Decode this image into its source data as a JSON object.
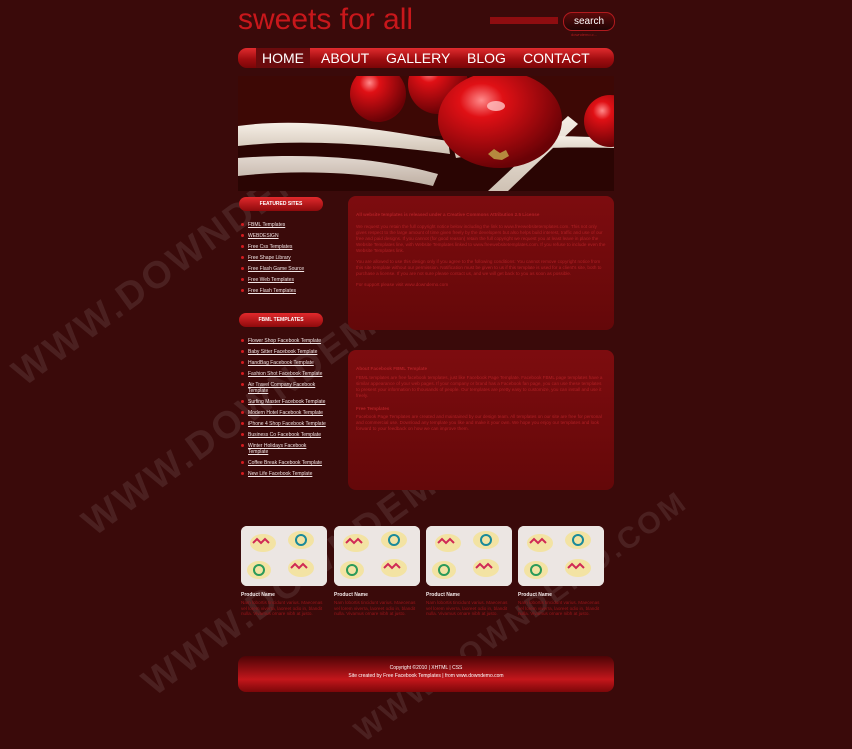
{
  "site": {
    "title": "sweets for all"
  },
  "search": {
    "button_label": "search",
    "note": "downdemo.c..."
  },
  "nav": {
    "items": [
      "HOME",
      "ABOUT",
      "GALLERY",
      "BLOG",
      "CONTACT"
    ]
  },
  "sidebar": {
    "featured_heading": "FEATURED SITES",
    "featured_items": [
      "FBML Templates",
      "WEBDESIGN",
      "Free Css Templates",
      "Free Shape Library",
      "Free Flash Game Source",
      "Free Web Templates",
      "Free Flash Templates"
    ],
    "fbml_heading": "FBML TEMPLATES",
    "fbml_items": [
      "Flower Shop Facebook Template",
      "Baby Sitter Facebook Template",
      "HandBag Facebook Template",
      "Fashion Shot Facebook Template",
      "Air Travel Company Facebook Template",
      "Surfing Master Facebook Template",
      "Modern Hotel Facebook Template",
      "iPhone 4 Shop Facebook Template",
      "Business Co Facebook Template",
      "Winter Holidays Facebook Template",
      "Coffee Break Facebook Template",
      "New Life Facebook Template"
    ]
  },
  "content": {
    "box1_heading": "All website templates is released under a Creative Commons Attribution 2.5 License",
    "box1_p1": "We request you retain the full copyright notice below including the link to www.freewebsitetemplates.com. This not only gives respect to the large amount of time given freely by the developers but also helps build interest, traffic and use of our free and paid designs. If you cannot (for good reason) retain the full copyright we request you at least leave in place the Website Templates line, with Website Templates linked to www.freewebsitetemplates.com. If you refuse to include even the Website Templates link.",
    "box1_p2": "You are allowed to use this design only if you agree to the following conditions: You cannot remove copyright notice from this site template without our permission. Notification must be given to us if this template is used for a client's site, both to purchase a license. If you are not sure please contact us, and we will get back to you as soon as possible.",
    "box1_p3": "For support please visit www.downdemo.com",
    "box2_heading": "About Facebook FBML Template",
    "box2_p1": "FBML templates are free facebook templates, just like Facebook Page Template. Facebook FBML page templates have a similar appearance of your web pages. If your company or brand has a Facebook fan page, you can use these templates to present your information to thousands of people. Our templates are pretty easy to customize, you can install and use it freely.",
    "box2_heading2": "Free Templates",
    "box2_p2": "Facebook Page Templates are created and maintained by our design team. All templates on our site are free for personal and commercial use. Download any template you like and make it your own. We hope you enjoy our templates and look forward to your feedback on how we can improve them.",
    "products": [
      {
        "name": "Product Name",
        "desc": "Nam lobortis tincidunt varius. Maecenas vel lorem viverra, laoreet odio in, blandit nulla. Vivamus ornare nibh at justo."
      },
      {
        "name": "Product Name",
        "desc": "Nam lobortis tincidunt varius. Maecenas vel lorem viverra, laoreet odio in, blandit nulla. Vivamus ornare nibh at justo."
      },
      {
        "name": "Product Name",
        "desc": "Nam lobortis tincidunt varius. Maecenas vel lorem viverra, laoreet odio in, blandit nulla. Vivamus ornare nibh at justo."
      },
      {
        "name": "Product Name",
        "desc": "Nam lobortis tincidunt varius. Maecenas vel lorem viverra, laoreet odio in, blandit nulla. Vivamus ornare nibh at justo."
      }
    ]
  },
  "footer": {
    "line1": "Copyright ©2010 | XHTML | CSS",
    "line2": "Site created by Free Facebook Templates | from www.downdemo.com"
  },
  "watermark": {
    "text": "WWW.DOWNDEMO.COM"
  },
  "colors": {
    "background": "#3a0a0a",
    "accent": "#c8171b",
    "box": "#6e0a0c"
  }
}
